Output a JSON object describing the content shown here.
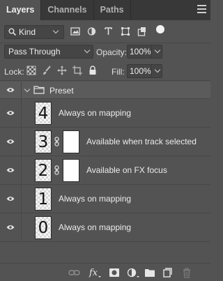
{
  "tabs": [
    {
      "label": "Layers",
      "active": true
    },
    {
      "label": "Channels",
      "active": false
    },
    {
      "label": "Paths",
      "active": false
    }
  ],
  "filter": {
    "kind_label": "Kind",
    "icons": [
      "pixel-layer-filter-icon",
      "adjustment-layer-filter-icon",
      "type-layer-filter-icon",
      "shape-layer-filter-icon",
      "smart-object-filter-icon"
    ],
    "filter_toggle": "on"
  },
  "blend": {
    "mode": "Pass Through",
    "opacity_label": "Opacity:",
    "opacity_value": "100%"
  },
  "lock": {
    "label": "Lock:",
    "icons": [
      "lock-transparent-pixels-icon",
      "lock-image-pixels-icon",
      "lock-position-icon",
      "lock-artboard-icon",
      "lock-all-icon"
    ],
    "fill_label": "Fill:",
    "fill_value": "100%"
  },
  "group": {
    "name": "Preset",
    "expanded": true
  },
  "layers": [
    {
      "thumb": "4",
      "name": "Always on mapping",
      "has_mask": false
    },
    {
      "thumb": "3",
      "name": "Available when track selected",
      "has_mask": true
    },
    {
      "thumb": "2",
      "name": "Available on FX focus",
      "has_mask": true
    },
    {
      "thumb": "1",
      "name": "Always on mapping",
      "has_mask": false
    },
    {
      "thumb": "0",
      "name": "Always on mapping",
      "has_mask": false
    }
  ],
  "bottom_icons": [
    "link-layers-icon",
    "fx-icon",
    "add-mask-icon",
    "adjustment-layer-icon",
    "new-group-icon",
    "new-layer-icon",
    "delete-icon"
  ],
  "colors": {
    "panel": "#535353",
    "tab_bar": "#383838",
    "text": "#e6e6e6"
  }
}
